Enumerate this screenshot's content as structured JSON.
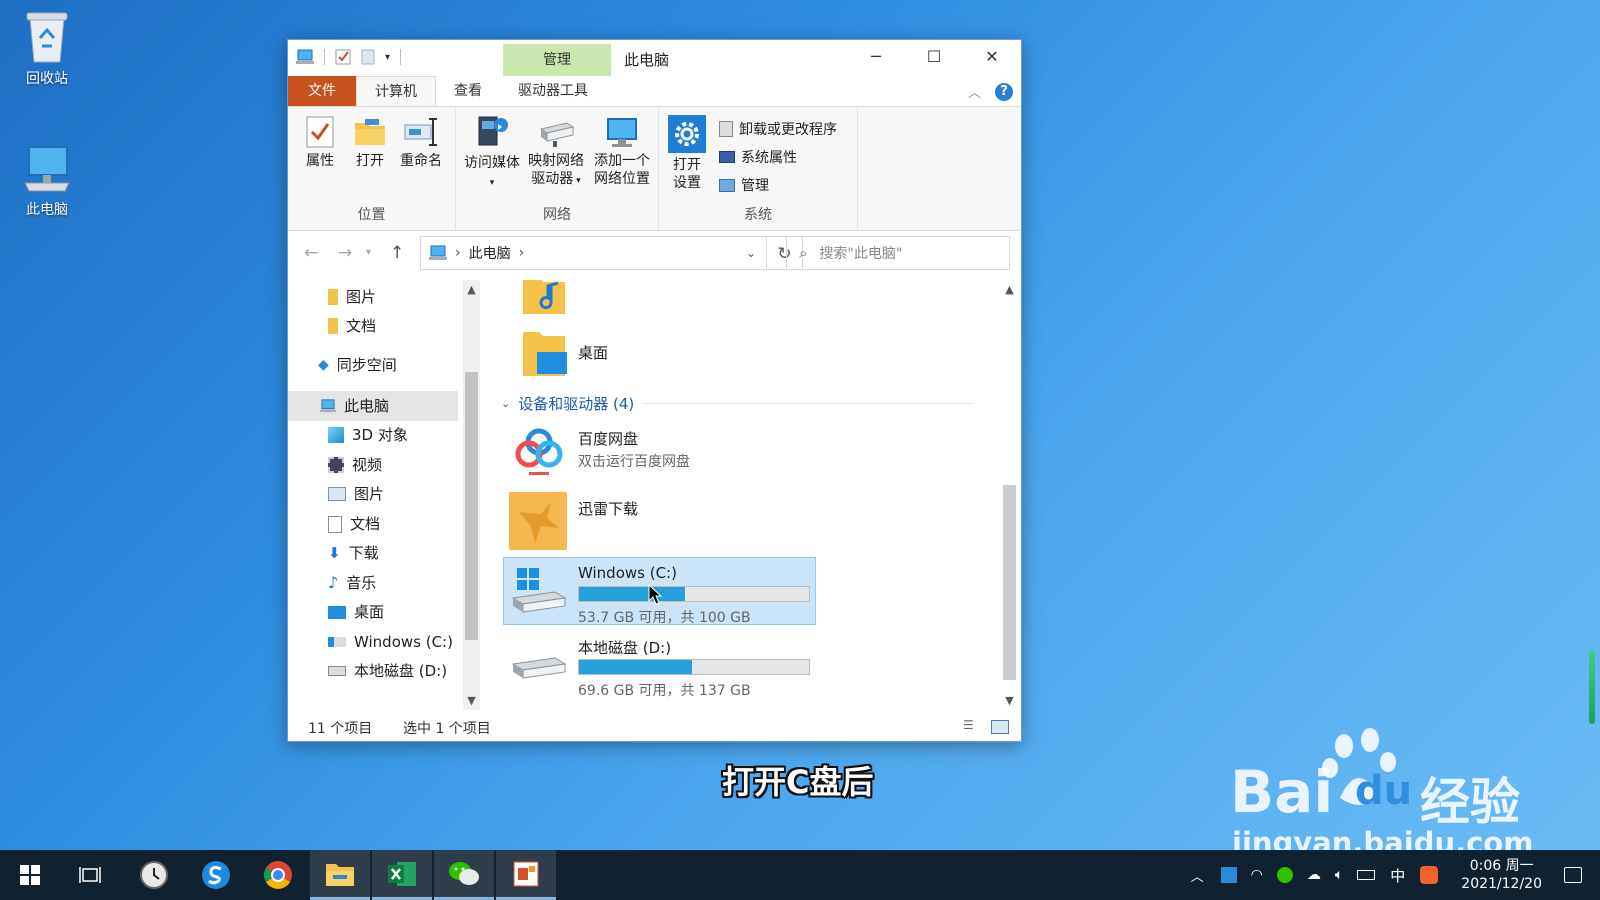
{
  "desktop": {
    "icons": [
      {
        "label": "回收站",
        "icon": "recycle-bin-icon"
      },
      {
        "label": "此电脑",
        "icon": "this-pc-icon"
      }
    ]
  },
  "window": {
    "title": "此电脑",
    "context_tab": "管理",
    "tabs": [
      "文件",
      "计算机",
      "查看",
      "驱动器工具"
    ],
    "help": "?",
    "ribbon": {
      "location": {
        "label": "位置",
        "buttons": [
          "属性",
          "打开",
          "重命名"
        ]
      },
      "network": {
        "label": "网络",
        "media": "访问媒体",
        "map_drive_l1": "映射网络",
        "map_drive_l2": "驱动器",
        "add_location_l1": "添加一个",
        "add_location_l2": "网络位置"
      },
      "system": {
        "label": "系统",
        "open_settings_l1": "打开",
        "open_settings_l2": "设置",
        "uninstall": "卸载或更改程序",
        "sys_props": "系统属性",
        "manage": "管理"
      }
    },
    "address": {
      "path": "此电脑",
      "search_placeholder": "搜索\"此电脑\""
    },
    "nav": {
      "items": [
        {
          "label": "图片",
          "icon": "folder-icon"
        },
        {
          "label": "文档",
          "icon": "folder-icon"
        },
        {
          "label": "同步空间",
          "icon": "sync-space-icon"
        },
        {
          "label": "此电脑",
          "icon": "this-pc-icon"
        },
        {
          "label": "3D 对象",
          "icon": "3d-objects-icon"
        },
        {
          "label": "视频",
          "icon": "video-icon"
        },
        {
          "label": "图片",
          "icon": "pictures-icon"
        },
        {
          "label": "文档",
          "icon": "documents-icon"
        },
        {
          "label": "下载",
          "icon": "download-icon"
        },
        {
          "label": "音乐",
          "icon": "music-icon"
        },
        {
          "label": "桌面",
          "icon": "desktop-icon"
        },
        {
          "label": "Windows (C:)",
          "icon": "drive-c-icon"
        },
        {
          "label": "本地磁盘 (D:)",
          "icon": "drive-d-icon"
        }
      ],
      "selected_index": 3
    },
    "content": {
      "desktop_folder": "桌面",
      "group_header": "设备和驱动器 (4)",
      "baidu": {
        "name": "百度网盘",
        "sub": "双击运行百度网盘"
      },
      "xunlei": {
        "name": "迅雷下载"
      },
      "drive_c": {
        "name": "Windows (C:)",
        "info": "53.7 GB 可用，共 100 GB",
        "used_fraction": 0.463
      },
      "drive_d": {
        "name": "本地磁盘 (D:)",
        "info": "69.6 GB 可用，共 137 GB",
        "used_fraction": 0.492
      }
    },
    "status": {
      "count": "11 个项目",
      "selected": "选中 1 个项目"
    }
  },
  "caption": "打开C盘后",
  "watermark": {
    "brand_a": "Bai",
    "brand_b": "du",
    "brand_cn": "经验",
    "url": "jingyan.baidu.com"
  },
  "taskbar": {
    "apps": [
      "start-icon",
      "task-view-icon",
      "clock-app-icon",
      "sogou-browser-icon",
      "chrome-icon",
      "file-explorer-icon",
      "excel-icon",
      "wechat-icon",
      "powerpoint-icon"
    ],
    "active_app": "file-explorer-icon",
    "ime": "中",
    "time": "0:06 周一",
    "date": "2021/12/20"
  },
  "colors": {
    "file_tab": "#c6521e",
    "context_tab": "#c9e8b0",
    "selection": "#cce4f7",
    "progress": "#26a0da",
    "taskbar": "#10212f"
  }
}
